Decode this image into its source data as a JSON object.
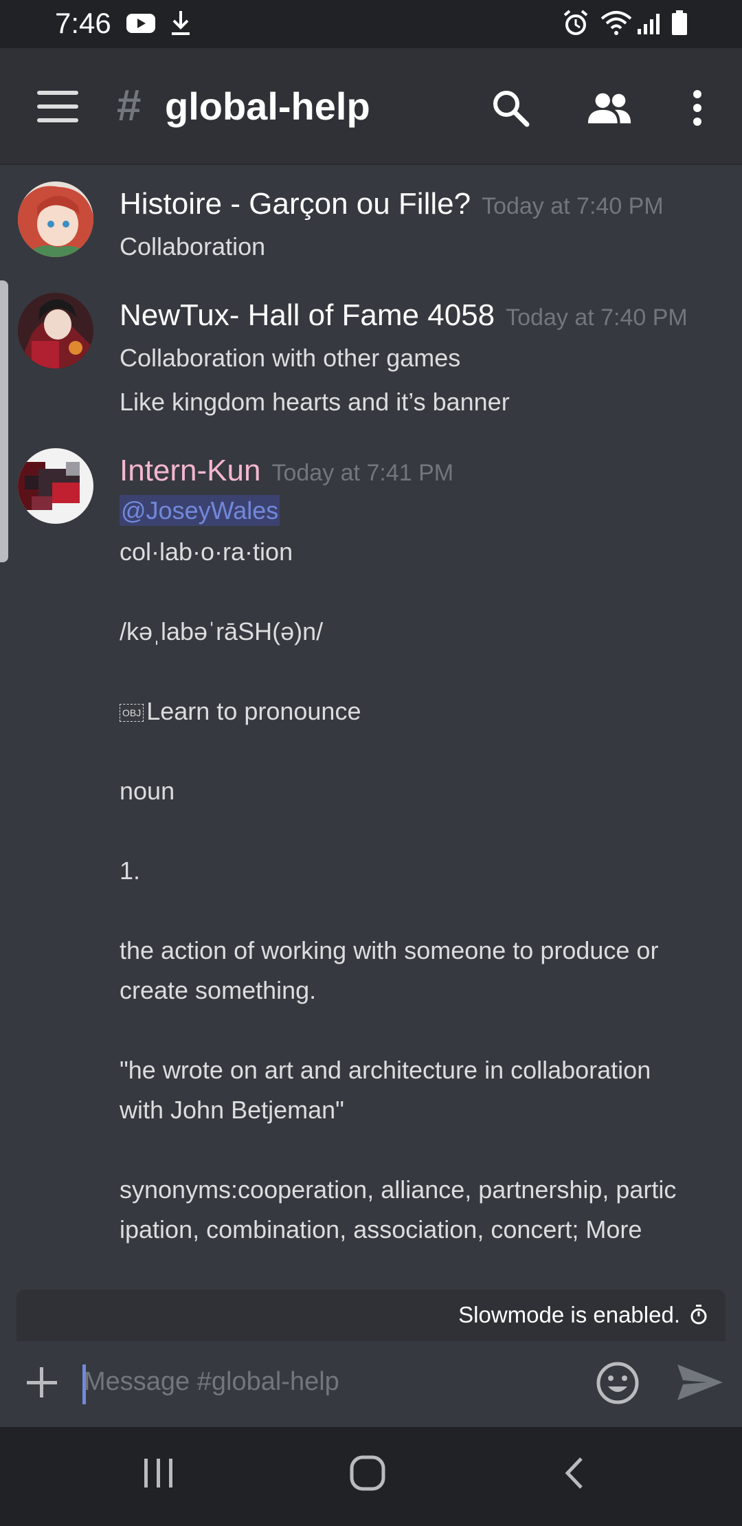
{
  "status_bar": {
    "time": "7:46"
  },
  "header": {
    "channel_prefix": "#",
    "channel_name": "global-help"
  },
  "messages": [
    {
      "author": "Histoire - Garçon ou Fille?",
      "author_color": "#ffffff",
      "timestamp": "Today at 7:40 PM",
      "lines": [
        "Collaboration"
      ]
    },
    {
      "author": "NewTux- Hall of Fame 4058",
      "author_color": "#ffffff",
      "timestamp": "Today at 7:40 PM",
      "lines": [
        "Collaboration with other games",
        "Like kingdom hearts and it’s banner"
      ]
    },
    {
      "author": "Intern-Kun",
      "author_color": "#f5b7d0",
      "timestamp": "Today at 7:41 PM",
      "mention": "@JoseyWales",
      "obj_glyph": "OBJ",
      "lines": [
        "col·lab·o·ra·tion",
        "/kəˌlabəˈrāSH(ə)n/",
        "Learn to pronounce",
        "noun",
        "1.",
        "the action of working with someone to produce or",
        "create something.",
        "\"he wrote on art and architecture in collaboration",
        "with John Betjeman\"",
        "synonyms:cooperation, alliance, partnership, partic",
        "ipation, combination, association, concert; More"
      ]
    }
  ],
  "slowmode": {
    "text": "Slowmode is enabled."
  },
  "composer": {
    "placeholder": "Message #global-help"
  },
  "colors": {
    "accent": "#7289da",
    "background": "#36393f",
    "header": "#2f3136",
    "statusbar": "#202225"
  }
}
